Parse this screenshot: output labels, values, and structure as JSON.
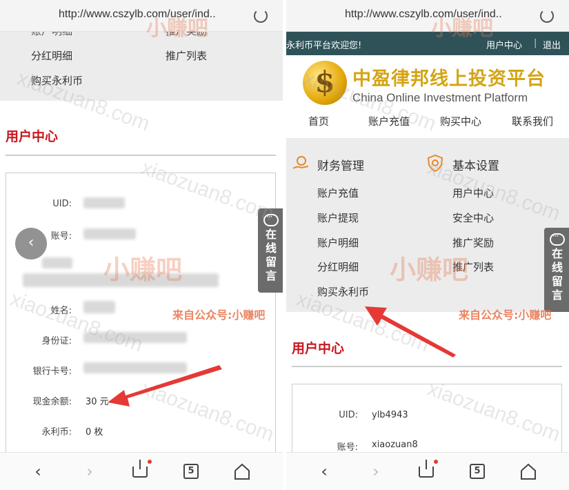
{
  "left": {
    "url": "http://www.cszylb.com/user/ind..",
    "menu_top_cut": [
      "账户明细",
      "推广奖励"
    ],
    "menu_links": [
      "分红明细",
      "推广列表",
      "购买永利币"
    ],
    "section_title": "用户中心",
    "fields": [
      {
        "label": "UID:",
        "value": ""
      },
      {
        "label": "账号:",
        "value": ""
      },
      {
        "label": "姓名:",
        "value": ""
      },
      {
        "label": "身份证:",
        "value": ""
      },
      {
        "label": "银行卡号:",
        "value": ""
      },
      {
        "label": "现金余额:",
        "value": "30 元"
      },
      {
        "label": "永利币:",
        "value": "0 枚"
      }
    ],
    "side_tab": "在线留言",
    "back_icon": "chevron-left-icon"
  },
  "right": {
    "url": "http://www.cszylb.com/user/ind..",
    "welcome": "永利币平台欢迎您!",
    "user_center_link": "用户中心",
    "separator": "|",
    "logout_link": "退出",
    "brand_symbol": "$",
    "brand_cn": "中盈律邦线上投资平台",
    "brand_en": "China Online Investment Platform",
    "nav": [
      "首页",
      "账户充值",
      "购买中心",
      "联系我们"
    ],
    "finance_title": "财务管理",
    "finance_links": [
      "账户充值",
      "账户提现",
      "账户明细",
      "分红明细",
      "购买永利币"
    ],
    "settings_title": "基本设置",
    "settings_links": [
      "用户中心",
      "安全中心",
      "推广奖励",
      "推广列表"
    ],
    "section_title": "用户中心",
    "fields": [
      {
        "label": "UID:",
        "value": "ylb4943"
      },
      {
        "label": "账号:",
        "value": "xiaozuan8"
      }
    ],
    "side_tab": "在线留言"
  },
  "browser": {
    "back": "‹",
    "forward": "›",
    "tabs_count": "5"
  },
  "watermark": {
    "site": "xiaozuan8.com",
    "logo": "小赚吧",
    "source_note": "来自公众号:小赚吧"
  },
  "colors": {
    "accent_red": "#c8161d",
    "header_teal": "#2f5259",
    "brand_gold": "#d4a414",
    "arrow_red": "#e53935"
  }
}
